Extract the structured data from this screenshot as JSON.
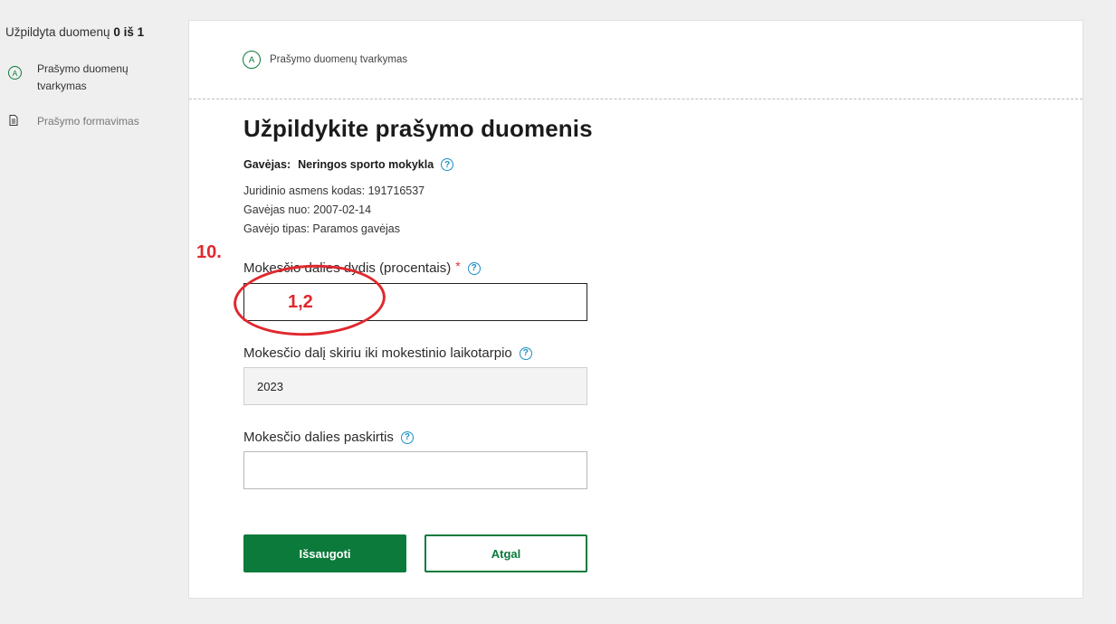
{
  "sidebar": {
    "progress_prefix": "Užpildyta duomenų",
    "progress_count": "0 iš 1",
    "steps": [
      {
        "badge": "A",
        "label": "Prašymo duomenų tvarkymas"
      },
      {
        "label": "Prašymo formavimas"
      }
    ]
  },
  "card": {
    "crumb_badge": "A",
    "crumb_label": "Prašymo duomenų tvarkymas",
    "heading": "Užpildykite prašymo duomenis",
    "receiver_key": "Gavėjas:",
    "receiver_value": "Neringos sporto mokykla",
    "info": [
      "Juridinio asmens kodas: 191716537",
      "Gavėjas nuo: 2007-02-14",
      "Gavėjo tipas: Paramos gavėjas"
    ],
    "fields": {
      "percent": {
        "label": "Mokesčio dalies dydis (procentais)",
        "required_mark": "*",
        "value": ""
      },
      "period": {
        "label": "Mokesčio dalį skiriu iki mokestinio laikotarpio",
        "value": "2023"
      },
      "purpose": {
        "label": "Mokesčio dalies paskirtis",
        "value": ""
      }
    },
    "help_glyph": "?",
    "buttons": {
      "save": "Išsaugoti",
      "back": "Atgal"
    }
  },
  "annotation": {
    "step_number": "10.",
    "value": "1,2"
  },
  "colors": {
    "accent": "#0b7a3b",
    "help": "#1a8fc4",
    "annotation": "#e0282e",
    "background": "#efefef"
  }
}
